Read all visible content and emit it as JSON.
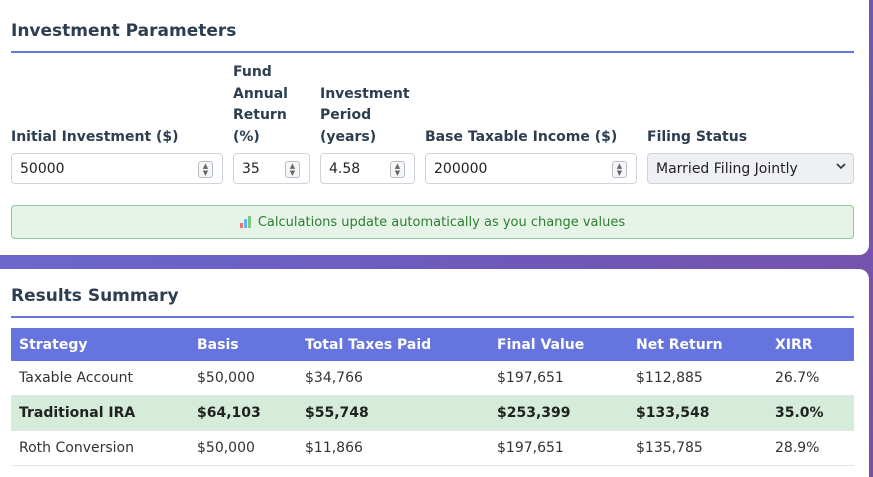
{
  "params": {
    "title": "Investment Parameters",
    "fields": [
      {
        "label": "Initial Investment ($)",
        "value": "50000"
      },
      {
        "label": "Fund Annual Return (%)",
        "value": "35"
      },
      {
        "label": "Investment Period (years)",
        "value": "4.58"
      },
      {
        "label": "Base Taxable Income ($)",
        "value": "200000"
      }
    ],
    "filing": {
      "label": "Filing Status",
      "value": "Married Filing Jointly"
    },
    "notice": "Calculations update automatically as you change values"
  },
  "results": {
    "title": "Results Summary",
    "columns": [
      "Strategy",
      "Basis",
      "Total Taxes Paid",
      "Final Value",
      "Net Return",
      "XIRR"
    ],
    "rows": [
      [
        "Taxable Account",
        "$50,000",
        "$34,766",
        "$197,651",
        "$112,885",
        "26.7%"
      ],
      [
        "Traditional IRA",
        "$64,103",
        "$55,748",
        "$253,399",
        "$133,548",
        "35.0%"
      ],
      [
        "Roth Conversion",
        "$50,000",
        "$11,866",
        "$197,651",
        "$135,785",
        "28.9%"
      ]
    ],
    "highlight_row": "Traditional IRA"
  },
  "colors": {
    "accent": "#6674e0",
    "highlight_row_bg": "#d4ecd9",
    "notice_bg": "#e6f4e8",
    "notice_text": "#2e7d32"
  },
  "icons": {
    "notice": "bar-chart-icon",
    "spinner": "spinner-arrows-icon",
    "select": "chevron-down-icon"
  }
}
